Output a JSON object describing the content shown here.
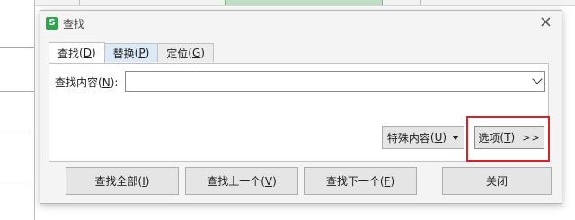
{
  "dialog": {
    "title": "查找",
    "app_icon_letter": "S",
    "close_symbol": "×"
  },
  "tabs": [
    {
      "label": "查找",
      "mnemonic": "D",
      "active": true
    },
    {
      "label": "替换",
      "mnemonic": "P",
      "active": false
    },
    {
      "label": "定位",
      "mnemonic": "G",
      "active": false
    }
  ],
  "find": {
    "label": "查找内容",
    "mnemonic": "N",
    "label_suffix": "):",
    "value": ""
  },
  "special_button": {
    "label": "特殊内容",
    "mnemonic": "U"
  },
  "options_button": {
    "label": "选项",
    "mnemonic": "T",
    "chevrons": ">>"
  },
  "bottom_buttons": [
    {
      "label": "查找全部",
      "mnemonic": "I"
    },
    {
      "label": "查找上一个",
      "mnemonic": "V"
    },
    {
      "label": "查找下一个",
      "mnemonic": "F"
    },
    {
      "label": "关闭"
    }
  ],
  "colors": {
    "accent_green": "#2fa34e",
    "highlight_red": "#d5232c",
    "tab_hover_blue": "#dceaf8"
  },
  "icons": [
    "app-logo-icon",
    "close-icon",
    "dropdown-arrow-icon"
  ]
}
